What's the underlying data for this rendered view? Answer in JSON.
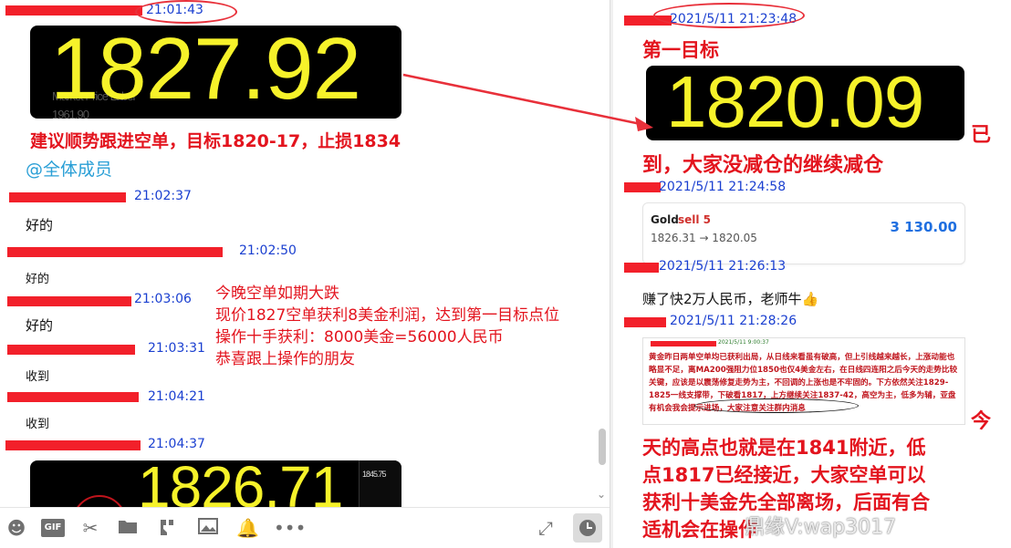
{
  "left_chat": {
    "messages": [
      {
        "time": "21:01:43"
      },
      {
        "time": "21:02:37",
        "text": "好的"
      },
      {
        "time": "21:02:50",
        "text": "好的"
      },
      {
        "time": "21:03:06",
        "text": "好的"
      },
      {
        "time": "21:03:31",
        "text": "收到"
      },
      {
        "time": "21:04:21",
        "text": "收到"
      },
      {
        "time": "21:04:37"
      }
    ],
    "price_card_1": {
      "price": "1827.92",
      "ghost_label": "Market Price Label",
      "ghost_value": "1961.90"
    },
    "advice": "建议顺势跟进空单，目标1820-17，止损1834",
    "mention": "@全体成员",
    "annotation_lines": [
      "今晚空单如期大跌",
      "现价1827空单获利8美金利润，达到第一目标点位",
      "操作十手获利：8000美金=56000人民币",
      "恭喜跟上操作的朋友"
    ],
    "price_card_2": {
      "price": "1826.71",
      "side_value": "1845.75"
    }
  },
  "toolbar": {
    "icons": [
      "emoji-icon",
      "gif-icon",
      "scissors-icon",
      "folder-icon",
      "phone-icon",
      "image-icon",
      "bell-icon",
      "more-icon",
      "expand-icon",
      "clock-icon"
    ],
    "gif_label": "GIF"
  },
  "right_chat": {
    "msg1_time": "2021/5/11 21:23:48",
    "first_target": "第一目标",
    "price_card": {
      "price": "1820.09"
    },
    "target_hit_a": "已",
    "target_hit_b": "到，大家没减仓的继续减仓",
    "msg2_time": "2021/5/11 21:24:58",
    "trade": {
      "symbol": "Gold",
      "action": "sell 5",
      "path": "1826.31 → 1820.05",
      "profit": "3 130.00"
    },
    "msg3_time": "2021/5/11 21:26:13",
    "msg3_text": "赚了快2万人民币，老师牛👍",
    "msg4_time": "2021/5/11 21:28:26",
    "note_header_time": "2021/5/11 9:00:37",
    "note_text": "黄金昨日两单空单均已获利出局，从日线来看虽有破高，但上引线越来越长，上涨动能也略显不足，离MA200强阻力位1850也仅4美金左右，在日线四连阳之后今天的走势比较关键，应该是以震荡修复走势为主，不回调的上涨也是不牢固的。下方依然关注1829-1825一线支撑带，下破看1817，上方继续关注1837-42，高空为主，低多为辅，亚盘有机会我会提示进场，大家注意关注群内消息",
    "analysis_a": "今",
    "analysis_lines": [
      "天的高点也就是在1841附近，低",
      "点1817已经接近，大家空单可以",
      "获利十美金先全部离场，后面有合",
      "适机会在操作"
    ],
    "watermark": "鼎缘V:wap3017"
  },
  "colors": {
    "timestamp": "#1a3fd0",
    "annotation_red": "#e3141e",
    "price_yellow": "#f6f22a",
    "profit_blue": "#1f6fe0",
    "mention_blue": "#2a9fd6"
  }
}
